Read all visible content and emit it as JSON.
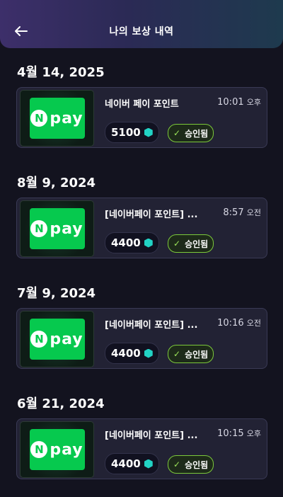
{
  "header": {
    "title": "나의 보상 내역",
    "back_icon": "arrow-left-icon"
  },
  "rewards": [
    {
      "date": "4월 14, 2025",
      "name": "네이버 페이 포인트",
      "time": "10:01",
      "ampm": "오후",
      "points": "5100",
      "status": "승인됨"
    },
    {
      "date": "8월 9, 2024",
      "name": "[네이버페이 포인트] ...",
      "time": "8:57",
      "ampm": "오전",
      "points": "4400",
      "status": "승인됨"
    },
    {
      "date": "7월 9, 2024",
      "name": "[네이버페이 포인트] ...",
      "time": "10:16",
      "ampm": "오전",
      "points": "4400",
      "status": "승인됨"
    },
    {
      "date": "6월 21, 2024",
      "name": "[네이버페이 포인트] ...",
      "time": "10:15",
      "ampm": "오후",
      "points": "4400",
      "status": "승인됨"
    }
  ],
  "logo": {
    "n": "N",
    "text": "pay",
    "color": "#06c94e"
  },
  "colors": {
    "accent_gem": "#22d3c5",
    "approved": "#7cc93a"
  }
}
